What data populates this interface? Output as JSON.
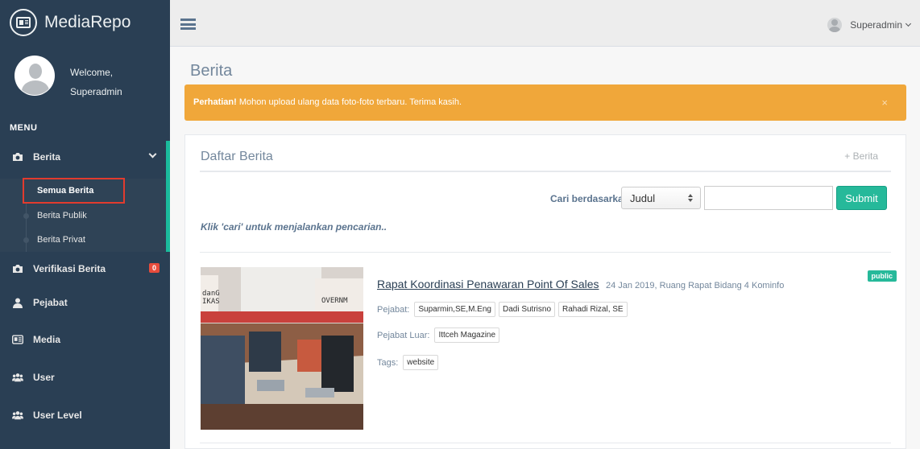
{
  "app": {
    "title": "MediaRepo"
  },
  "profile": {
    "welcome": "Welcome,",
    "name": "Superadmin"
  },
  "menu": {
    "title": "MENU",
    "items": [
      {
        "label": "Berita",
        "icon": "camera-icon"
      },
      {
        "label": "Verifikasi Berita",
        "icon": "camera-icon",
        "badge": "0"
      },
      {
        "label": "Pejabat",
        "icon": "user-icon"
      },
      {
        "label": "Media",
        "icon": "newspaper-icon"
      },
      {
        "label": "User",
        "icon": "users-icon"
      },
      {
        "label": "User Level",
        "icon": "users-icon"
      }
    ],
    "submenu": [
      {
        "label": "Semua Berita"
      },
      {
        "label": "Berita Publik"
      },
      {
        "label": "Berita Privat"
      }
    ]
  },
  "topbar": {
    "user": "Superadmin"
  },
  "page": {
    "title": "Berita"
  },
  "alert": {
    "strong": "Perhatian!",
    "text": " Mohon upload ulang data foto-foto terbaru. Terima kasih.",
    "close": "×"
  },
  "panel": {
    "title": "Daftar Berita",
    "add_label": "+ Berita",
    "search": {
      "label": "Cari berdasarkan",
      "select_value": "Judul",
      "input_value": "",
      "submit_label": "Submit"
    },
    "hint": "Klik 'cari' untuk menjalankan pencarian.."
  },
  "news": [
    {
      "title": "Rapat Koordinasi Penawaran Point Of Sales",
      "meta": "24 Jan 2019, Ruang Rapat Bidang 4 Kominfo",
      "visibility": "public",
      "pejabat_label": "Pejabat:",
      "pejabat": [
        "Suparmin,SE,M.Eng",
        "Dadi Sutrisno",
        "Rahadi Rizal, SE"
      ],
      "pejabat_luar_label": "Pejabat Luar:",
      "pejabat_luar": [
        "Ittceh Magazine"
      ],
      "tags_label": "Tags:",
      "tags": [
        "website"
      ],
      "photo_text": {
        "left": "danG\nIKAS",
        "right": "OVERNM"
      }
    }
  ],
  "colors": {
    "sidebar": "#2A3F54",
    "accent": "#1ABB9C",
    "alert": "#F0A73A",
    "success": "#26B99A",
    "badge_red": "#E74C3C"
  }
}
